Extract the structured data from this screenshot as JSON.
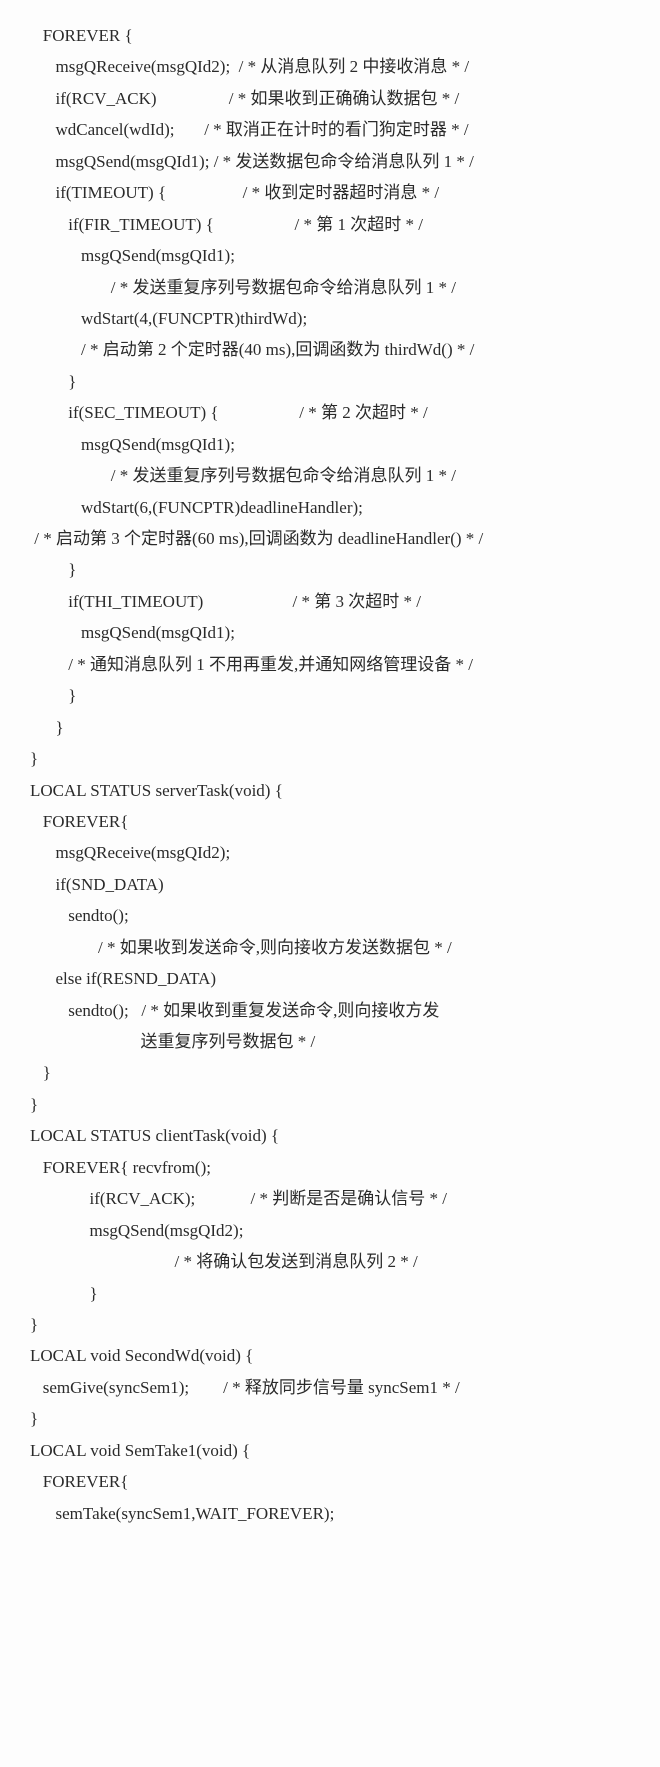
{
  "lines": [
    "   FOREVER {",
    "      msgQReceive(msgQId2);  / * 从消息队列 2 中接收消息 * /",
    "      if(RCV_ACK)                 / * 如果收到正确确认数据包 * /",
    "      wdCancel(wdId);       / * 取消正在计时的看门狗定时器 * /",
    "      msgQSend(msgQId1); / * 发送数据包命令给消息队列 1 * /",
    "      if(TIMEOUT) {                  / * 收到定时器超时消息 * /",
    "         if(FIR_TIMEOUT) {                   / * 第 1 次超时 * /",
    "            msgQSend(msgQId1);",
    "                   / * 发送重复序列号数据包命令给消息队列 1 * /",
    "            wdStart(4,(FUNCPTR)thirdWd);",
    "            / * 启动第 2 个定时器(40 ms),回调函数为 thirdWd() * /",
    "         }",
    "         if(SEC_TIMEOUT) {                   / * 第 2 次超时 * /",
    "            msgQSend(msgQId1);",
    "                   / * 发送重复序列号数据包命令给消息队列 1 * /",
    "            wdStart(6,(FUNCPTR)deadlineHandler);",
    " / * 启动第 3 个定时器(60 ms),回调函数为 deadlineHandler() * /",
    "         }",
    "         if(THI_TIMEOUT)                     / * 第 3 次超时 * /",
    "            msgQSend(msgQId1);",
    "         / * 通知消息队列 1 不用再重发,并通知网络管理设备 * /",
    "         }",
    "      }",
    "}",
    "LOCAL STATUS serverTask(void) {",
    "   FOREVER{",
    "      msgQReceive(msgQId2);",
    "      if(SND_DATA)",
    "         sendto();",
    "                / * 如果收到发送命令,则向接收方发送数据包 * /",
    "      else if(RESND_DATA)",
    "         sendto();   / * 如果收到重复发送命令,则向接收方发",
    "                          送重复序列号数据包 * /",
    "   }",
    "}",
    "LOCAL STATUS clientTask(void) {",
    "   FOREVER{ recvfrom();",
    "              if(RCV_ACK);             / * 判断是否是确认信号 * /",
    "              msgQSend(msgQId2);",
    "                                  / * 将确认包发送到消息队列 2 * /",
    "              }",
    "}",
    "LOCAL void SecondWd(void) {",
    "   semGive(syncSem1);        / * 释放同步信号量 syncSem1 * /",
    "}",
    "LOCAL void SemTake1(void) {",
    "   FOREVER{",
    "      semTake(syncSem1,WAIT_FOREVER);"
  ]
}
